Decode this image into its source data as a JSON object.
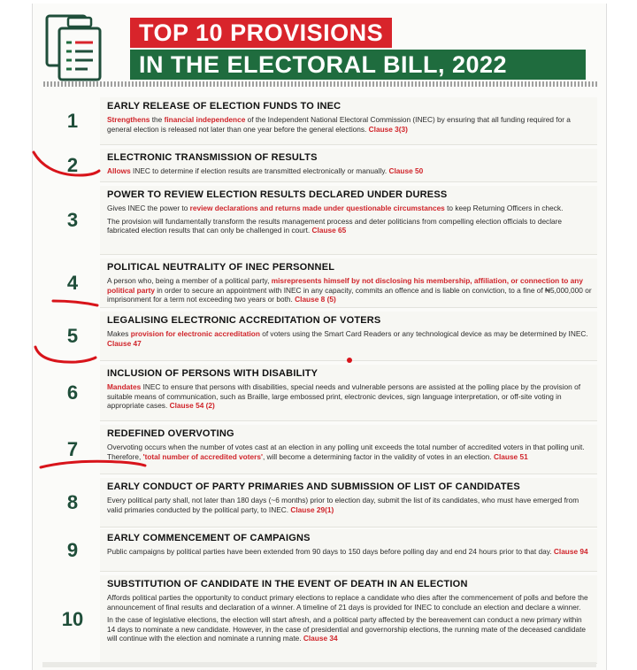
{
  "title": {
    "line1": "TOP 10 PROVISIONS",
    "line2": "IN THE ELECTORAL BILL, 2022"
  },
  "colors": {
    "red": "#d8242b",
    "green": "#1f6c3e",
    "number": "#1f4e3a",
    "pen_mark": "#d8141b"
  },
  "icons": [
    "document-icon"
  ],
  "provisions": [
    {
      "number": "1",
      "heading": "EARLY RELEASE OF ELECTION FUNDS TO INEC",
      "paragraphs": [
        [
          {
            "t": "Strengthens",
            "hl": true
          },
          {
            "t": " the "
          },
          {
            "t": "financial independence",
            "hl": true
          },
          {
            "t": " of the Independent National Electoral Commission (INEC) by ensuring that all funding required for a general election is released not later than one year before the general elections. "
          },
          {
            "t": "Clause 3(3)",
            "hl": true
          }
        ]
      ]
    },
    {
      "number": "2",
      "heading": "ELECTRONIC TRANSMISSION OF RESULTS",
      "paragraphs": [
        [
          {
            "t": "Allows",
            "hl": true
          },
          {
            "t": " INEC to determine if election results are transmitted electronically or manually. "
          },
          {
            "t": "Clause 50",
            "hl": true
          }
        ]
      ]
    },
    {
      "number": "3",
      "heading": "POWER TO REVIEW ELECTION RESULTS DECLARED UNDER DURESS",
      "paragraphs": [
        [
          {
            "t": "Gives INEC the power to "
          },
          {
            "t": "review declarations and returns made under questionable circumstances",
            "hl": true
          },
          {
            "t": " to keep Returning Officers in check."
          }
        ],
        [
          {
            "t": "The provision will fundamentally transform the results management process and deter politicians from compelling election officials to declare fabricated election results that can only be challenged in court. "
          },
          {
            "t": "Clause 65",
            "hl": true
          }
        ]
      ]
    },
    {
      "number": "4",
      "heading": "POLITICAL NEUTRALITY OF INEC PERSONNEL",
      "paragraphs": [
        [
          {
            "t": "A person who, being a member of a political party, "
          },
          {
            "t": "misrepresents himself by not disclosing his membership, affiliation, or connection to any political party",
            "hl": true
          },
          {
            "t": " in order to secure an appointment with INEC in any capacity, commits an offence and is liable on conviction, to a fine of ₦5,000,000 or imprisonment for a term not exceeding two years or both. "
          },
          {
            "t": "Clause 8 (5)",
            "hl": true
          }
        ]
      ]
    },
    {
      "number": "5",
      "heading": "LEGALISING ELECTRONIC ACCREDITATION OF VOTERS",
      "paragraphs": [
        [
          {
            "t": "Makes "
          },
          {
            "t": "provision for electronic accreditation",
            "hl": true
          },
          {
            "t": " of voters using the Smart Card Readers or any technological device as may be determined by INEC. "
          },
          {
            "t": "Clause 47",
            "hl": true
          }
        ]
      ]
    },
    {
      "number": "6",
      "heading": "INCLUSION OF PERSONS WITH DISABILITY",
      "paragraphs": [
        [
          {
            "t": "Mandates",
            "hl": true
          },
          {
            "t": " INEC to ensure that persons with disabilities, special needs and vulnerable persons are assisted at the polling place by the provision of suitable means of communication, such as Braille, large embossed print, electronic devices, sign language interpretation, or off-site voting in appropriate cases. "
          },
          {
            "t": "Clause 54 (2)",
            "hl": true
          }
        ]
      ]
    },
    {
      "number": "7",
      "heading": "REDEFINED OVERVOTING",
      "paragraphs": [
        [
          {
            "t": "Overvoting occurs when the number of votes cast at an election in any polling unit exceeds the total number of accredited voters in that polling unit. Therefore, "
          },
          {
            "t": "'total number of accredited voters'",
            "hl": true
          },
          {
            "t": ", will become a determining factor in the validity of votes in an election. "
          },
          {
            "t": "Clause 51",
            "hl": true
          }
        ]
      ]
    },
    {
      "number": "8",
      "heading": "EARLY CONDUCT OF PARTY PRIMARIES AND SUBMISSION OF LIST OF CANDIDATES",
      "paragraphs": [
        [
          {
            "t": "Every political party shall, not later than 180 days (~6 months) prior to election day, submit the list of its candidates, who must have emerged from valid primaries conducted by the political party, to INEC. "
          },
          {
            "t": "Clause 29(1)",
            "hl": true
          }
        ]
      ]
    },
    {
      "number": "9",
      "heading": "EARLY COMMENCEMENT OF CAMPAIGNS",
      "paragraphs": [
        [
          {
            "t": "Public campaigns by political parties have been extended from 90 days to 150 days before polling day and end 24 hours prior to that day. "
          },
          {
            "t": "Clause 94",
            "hl": true
          }
        ]
      ]
    },
    {
      "number": "10",
      "heading": "SUBSTITUTION OF CANDIDATE IN THE EVENT OF DEATH IN AN ELECTION",
      "paragraphs": [
        [
          {
            "t": "Affords political parties the opportunity to conduct primary elections to replace a candidate who dies after the commencement of polls and before the announcement of final results and declaration of a winner. A timeline of 21 days is provided for INEC to conclude an election and declare a winner."
          }
        ],
        [
          {
            "t": "In the case of legislative elections, the election will start afresh, and a political party affected by the bereavement can conduct a new primary within 14 days to nominate a new candidate. However, in the case of presidential and governorship elections, the running mate of the deceased candidate will continue with the election and nominate a running mate. "
          },
          {
            "t": "Clause 34",
            "hl": true
          }
        ]
      ]
    }
  ]
}
